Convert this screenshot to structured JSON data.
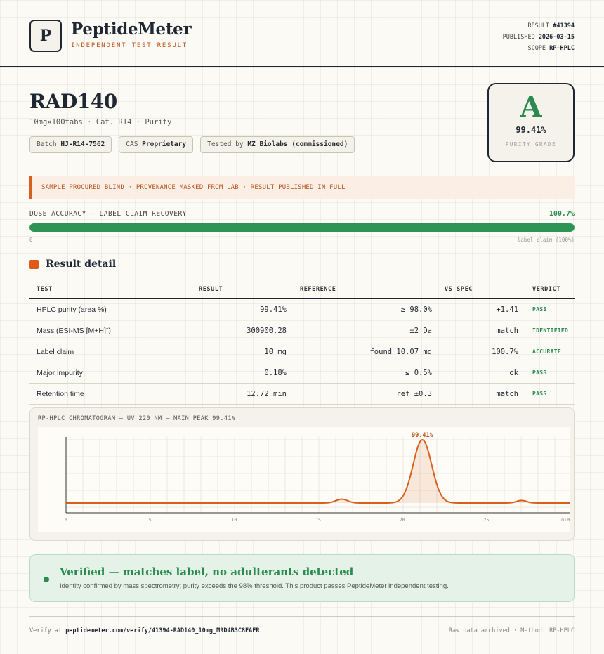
{
  "header": {
    "logo_letter": "P",
    "brand": "PeptideMeter",
    "brand_sub": "INDEPENDENT TEST RESULT",
    "result_label": "RESULT",
    "result_value": "#41394",
    "published_label": "PUBLISHED",
    "published_value": "2026-03-15",
    "scope_label": "SCOPE",
    "scope_value": "RP-HPLC"
  },
  "product": {
    "name": "RAD140",
    "subtitle": "10mg×100tabs · Cat. R14 · Purity",
    "batch_label": "Batch",
    "batch_value": "HJ-R14-7562",
    "cas_label": "CAS",
    "cas_value": "Proprietary",
    "tested_label": "Tested by",
    "tested_value": "MZ Biolabs (commissioned)"
  },
  "grade": {
    "letter": "A",
    "value": "99.41%",
    "label": "PURITY GRADE"
  },
  "notice": "SAMPLE PROCURED BLIND · PROVENANCE MASKED FROM LAB · RESULT PUBLISHED IN FULL",
  "dose": {
    "label": "DOSE ACCURACY — LABEL CLAIM RECOVERY",
    "value_text": "100.7%",
    "fill_fraction": 1.0,
    "min_label": "0",
    "max_label": "label claim (100%)"
  },
  "section_title": "Result detail",
  "table": {
    "headers": [
      "TEST",
      "RESULT",
      "REFERENCE",
      "VS SPEC",
      "VERDICT"
    ],
    "rows": [
      {
        "test": "HPLC purity (area %)",
        "result": "99.41%",
        "reference": "≥ 98.0%",
        "vs": "+1.41",
        "verdict": "PASS"
      },
      {
        "test": "Mass (ESI-MS [M+H]",
        "test_sup": "+",
        "test_end": ")",
        "result": "300900.28",
        "reference": "±2 Da",
        "vs": "match",
        "verdict": "IDENTIFIED"
      },
      {
        "test": "Label claim",
        "result": "10 mg",
        "reference": "found 10.07 mg",
        "vs": "100.7%",
        "verdict": "ACCURATE"
      },
      {
        "test": "Major impurity",
        "result": "0.18%",
        "reference": "≤ 0.5%",
        "vs": "ok",
        "verdict": "PASS"
      },
      {
        "test": "Retention time",
        "result": "12.72 min",
        "reference": "ref ±0.3",
        "vs": "match",
        "verdict": "PASS"
      }
    ]
  },
  "chromatogram": {
    "title": "RP-HPLC CHROMATOGRAM — UV 220 NM — MAIN PEAK 99.41%",
    "peak_label": "99.41%",
    "x_ticks": [
      "0",
      "5",
      "10",
      "15",
      "20",
      "25",
      "30",
      "min"
    ],
    "x_range": [
      0,
      30
    ],
    "color": "#d9601c",
    "peaks": [
      {
        "rt": 16.4,
        "height": 0.06
      },
      {
        "rt": 21.2,
        "height": 1.0
      },
      {
        "rt": 27.1,
        "height": 0.04
      }
    ]
  },
  "verified": {
    "title": "Verified — matches label, no adulterants detected",
    "subtitle": "Identity confirmed by mass spectrometry; purity exceeds the 98% threshold. This product passes PeptideMeter independent testing."
  },
  "footer": {
    "verify_prefix": "Verify at",
    "verify_url": "peptidemeter.com/verify/41394-RAD140_10mg_M9D4B3C8FAFR",
    "right": "Raw data archived · Method: RP-HPLC"
  }
}
